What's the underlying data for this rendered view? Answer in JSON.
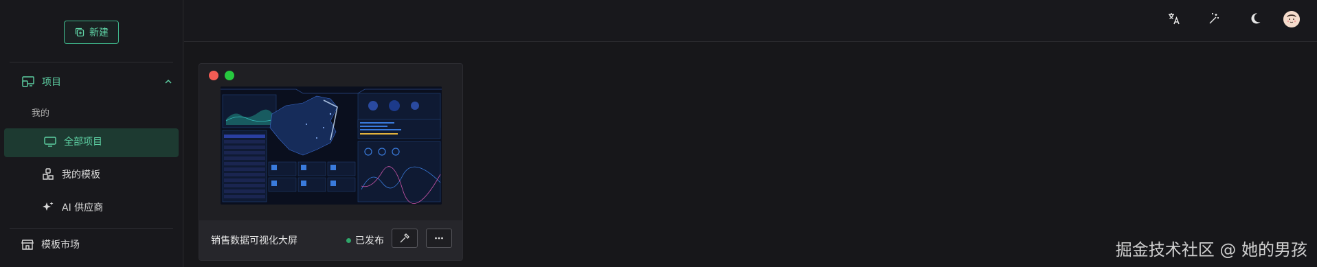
{
  "sidebar": {
    "new_label": "新建",
    "projects_label": "项目",
    "mine_label": "我的",
    "all_projects_label": "全部项目",
    "my_templates_label": "我的模板",
    "ai_vendor_label": "AI 供应商",
    "template_market_label": "模板市场"
  },
  "topbar": {
    "icons": [
      "translate-icon",
      "magic-wand-icon",
      "moon-icon",
      "user-avatar"
    ]
  },
  "card": {
    "title": "销售数据可视化大屏",
    "status": "已发布",
    "status_color": "#2fa66a"
  },
  "watermark": "掘金技术社区 @ 她的男孩",
  "colors": {
    "accent": "#5ed1a4",
    "background": "#17171a",
    "active_bg": "#1d3a31"
  }
}
